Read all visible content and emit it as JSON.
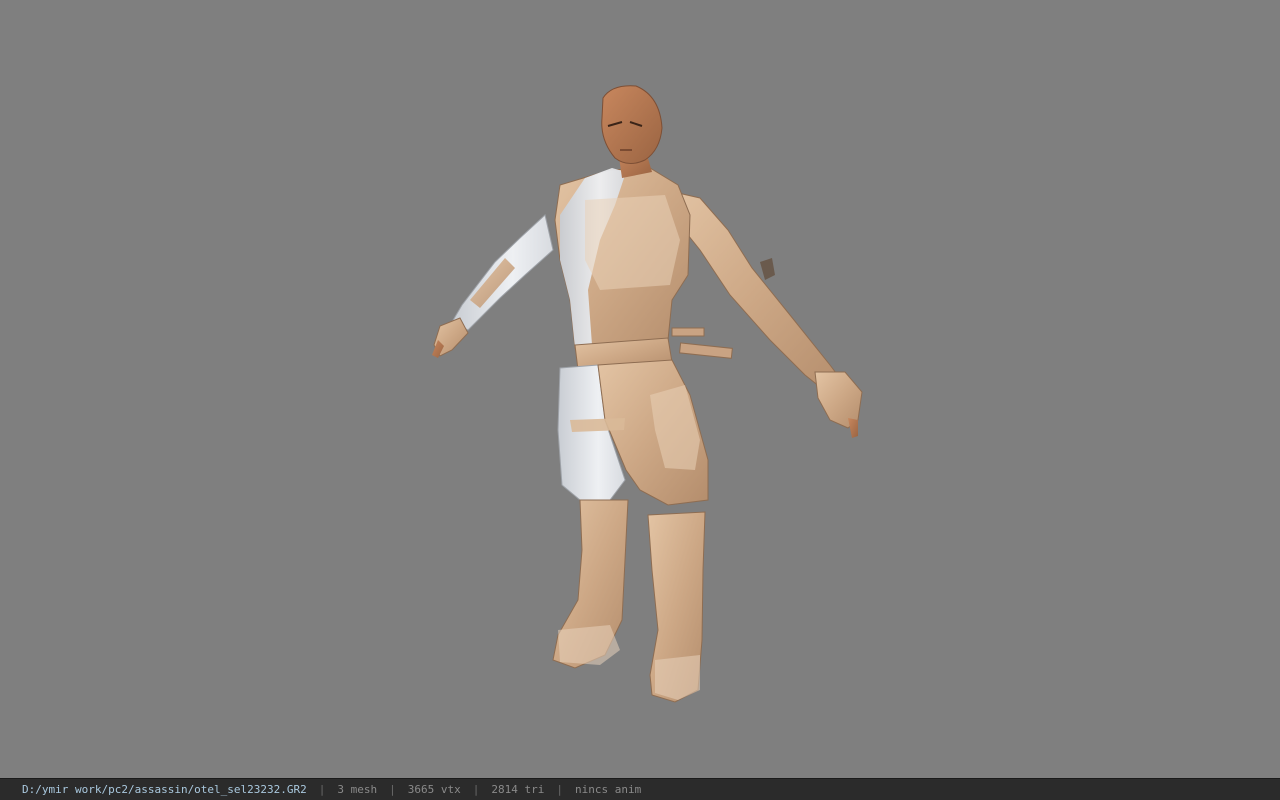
{
  "viewer": {
    "background_color": "#7f7f7f",
    "model_name": "assassin"
  },
  "status": {
    "file_path": "D:/ymir work/pc2/assassin/otel_sel23232.GR2",
    "separator": "|",
    "mesh": "3 mesh",
    "vertices": "3665 vtx",
    "triangles": "2814 tri",
    "anim": "nincs anim"
  },
  "colors": {
    "skin": "#b77a55",
    "cloth_tan": "#d2b08f",
    "cloth_white": "#e6e8ec",
    "statusbar": "#2b2b2b",
    "path_text": "#a9c8de"
  }
}
